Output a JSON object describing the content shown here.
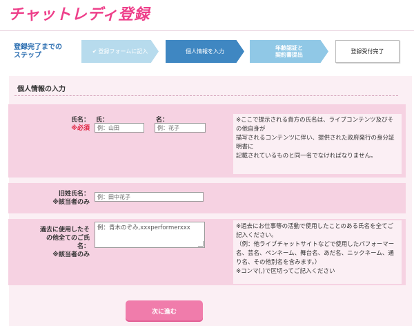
{
  "header": {
    "title": "チャットレディ登録"
  },
  "steps": {
    "label_line1": "登録完了までの",
    "label_line2": "ステップ",
    "items": [
      {
        "label": "登録フォームに記入",
        "state": "done"
      },
      {
        "label": "個人情報を入力",
        "state": "active"
      },
      {
        "label_line1": "年齢認証と",
        "label_line2": "契約書提出",
        "state": "next"
      },
      {
        "label": "登録受付完了",
        "state": "last"
      }
    ]
  },
  "section": {
    "title": "個人情報の入力"
  },
  "name_row": {
    "label": "氏名：",
    "required": "※必須",
    "surname_label": "氏：",
    "surname_placeholder": "例：山田",
    "given_label": "名：",
    "given_placeholder": "例：花子",
    "note": [
      "※ここで提示される貴方の氏名は、ライブコンテンツ及びその他自身が",
      "描写されるコンテンツに伴い、提供された政府発行の身分証明書に",
      "記載されているものと同一名でなければなりません。"
    ]
  },
  "maiden_row": {
    "label": "旧姓氏名：",
    "applicable": "※該当者のみ",
    "placeholder": "例：田中花子"
  },
  "aliases_row": {
    "label_line1": "過去に使用したそ",
    "label_line2": "の他全てのご氏",
    "label_line3": "名：",
    "applicable": "※該当者のみ",
    "value": "例：青木のぞみ,xxxperformerxxx",
    "note": [
      "※過去にお仕事等の活動で使用したことのある氏名を全てご記入ください。",
      "（例：他ライブチャットサイトなどで使用したパフォーマー名、芸名、ペンネーム、舞台名、あだ名、ニックネーム、通り名、その他別名を含みます。）",
      "※コンマ(,)で区切ってご記入ください"
    ]
  },
  "actions": {
    "next_label": "次に進む"
  },
  "colors": {
    "brand": "#ee3f8a",
    "step_active": "#3f87c2",
    "row_bg": "#f6d2e2",
    "button": "#f07cab"
  }
}
